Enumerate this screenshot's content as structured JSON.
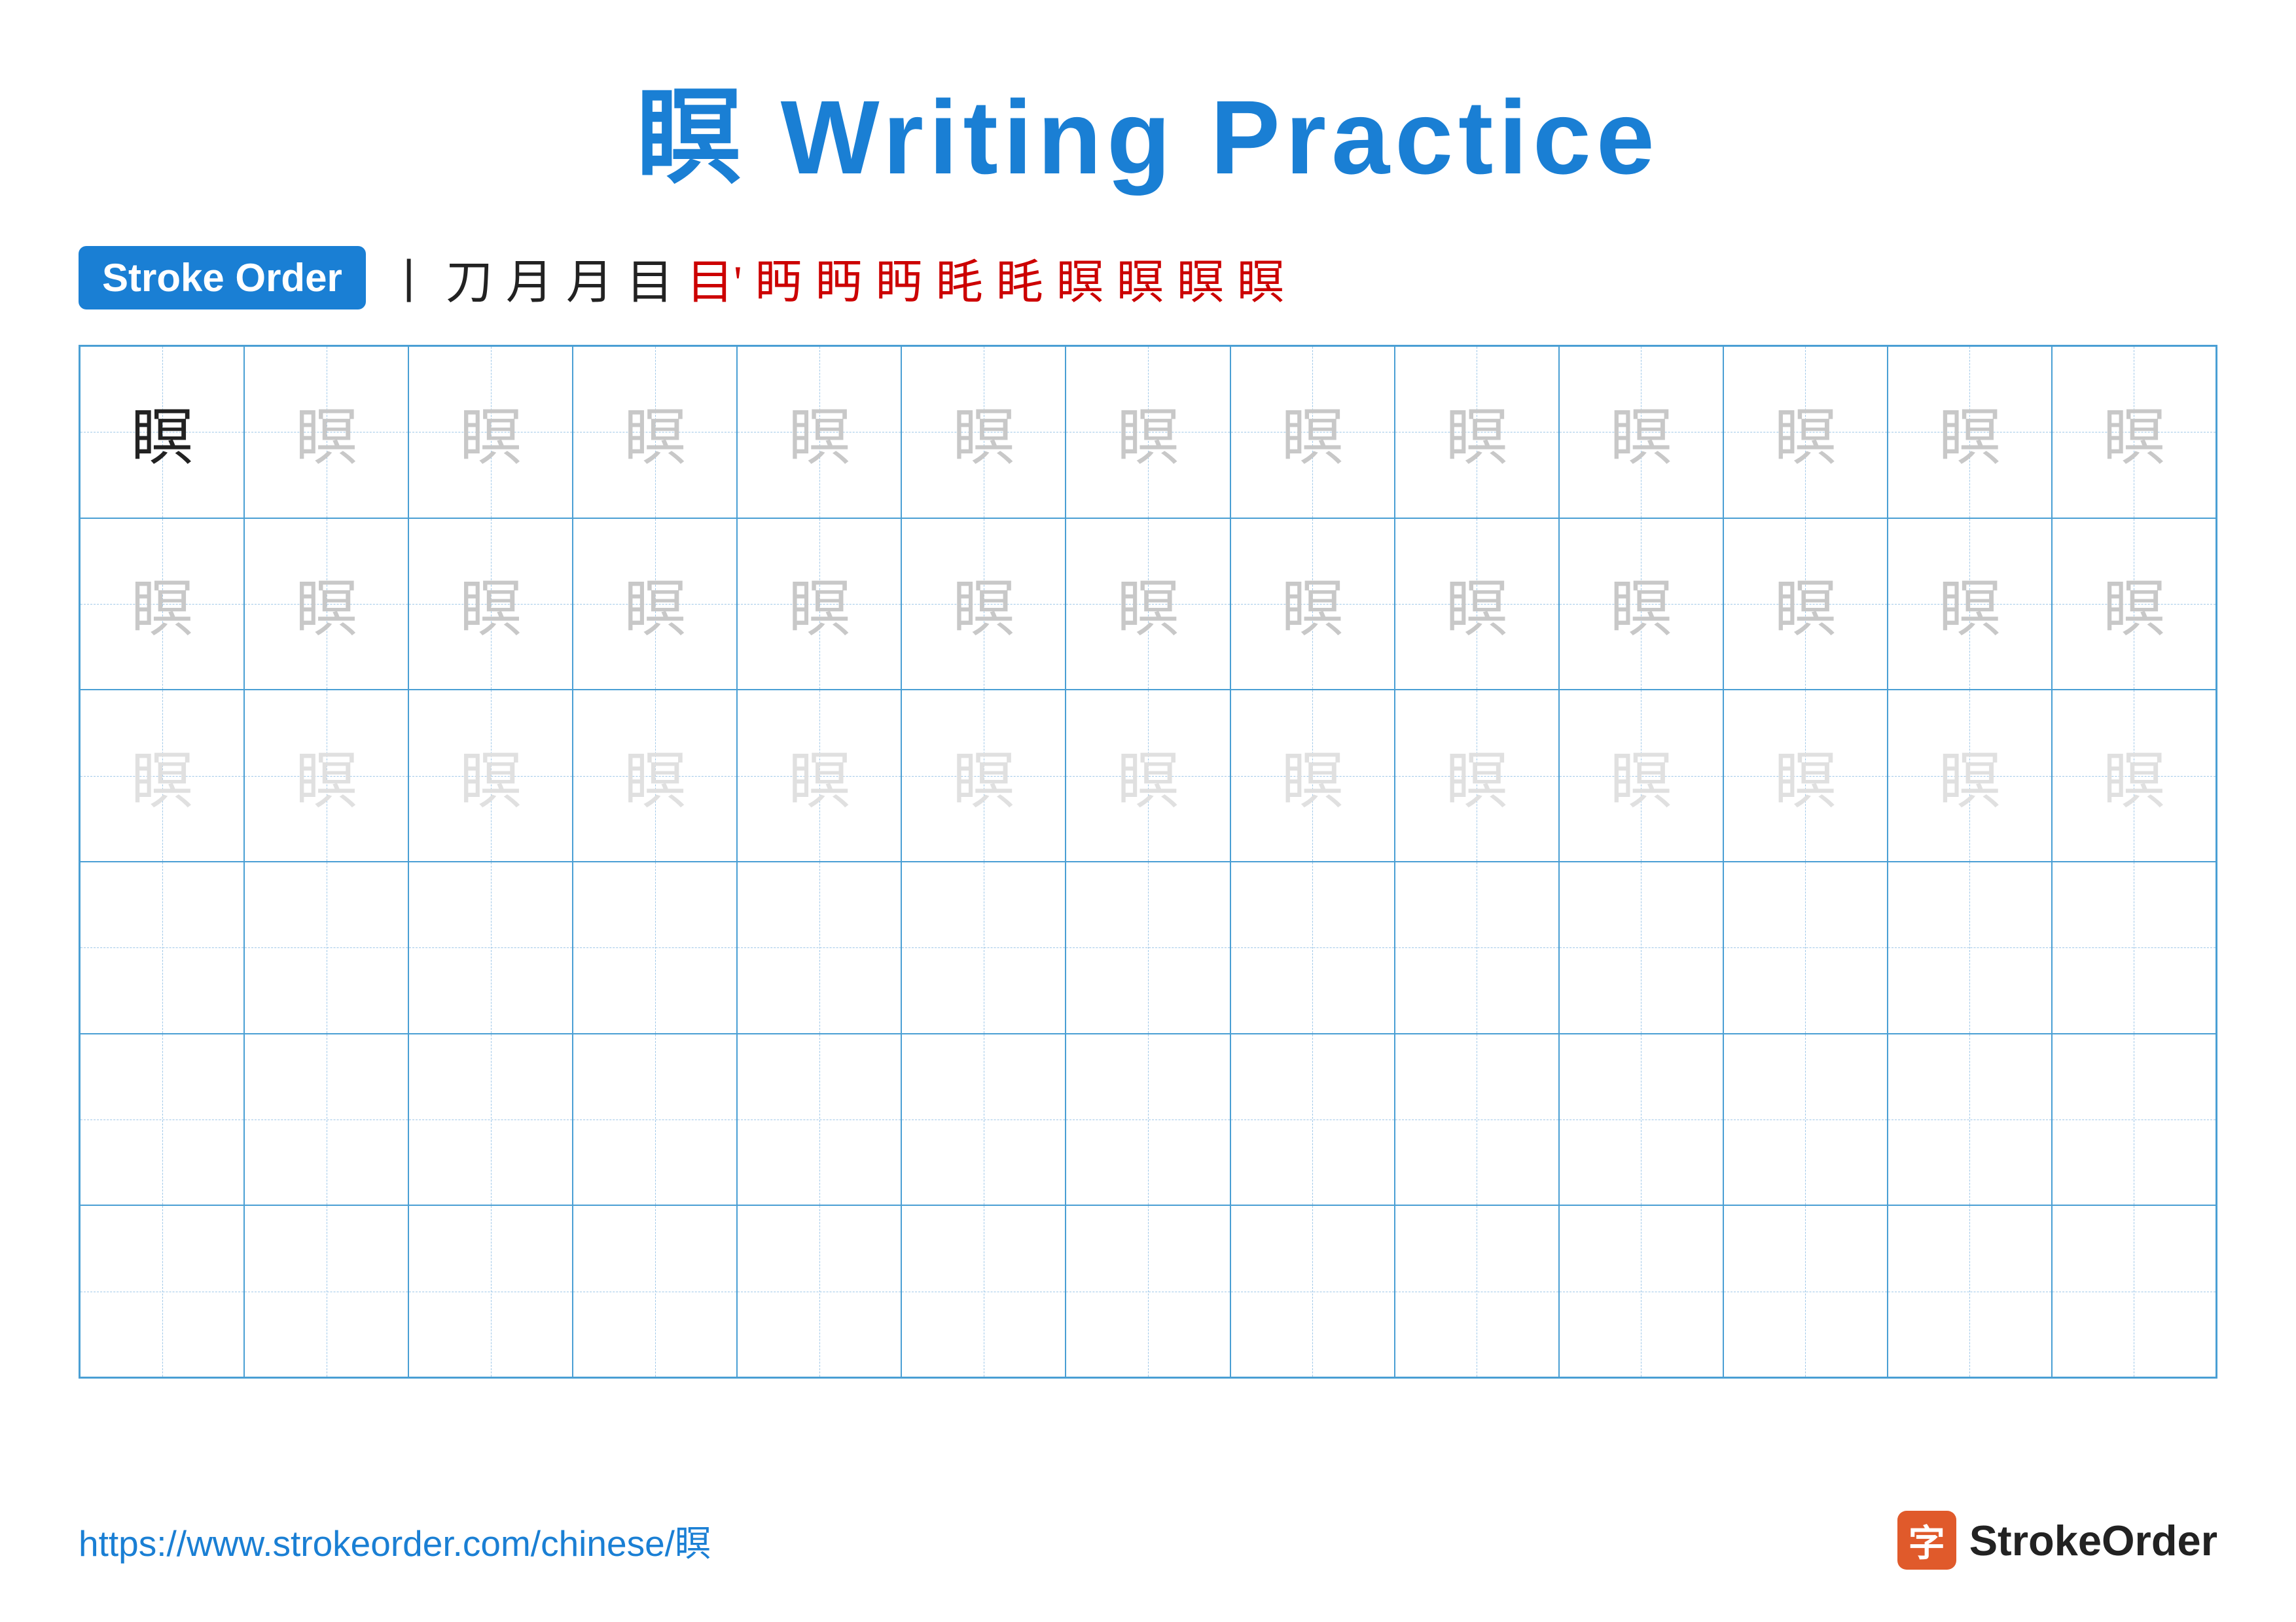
{
  "title": {
    "text": "瞑 Writing Practice",
    "char": "瞑"
  },
  "stroke_order": {
    "badge_label": "Stroke Order",
    "chars": [
      "丨",
      "刀",
      "月",
      "月",
      "目",
      "目'",
      "眄",
      "眄",
      "眄",
      "眄",
      "眊",
      "眊",
      "瞑",
      "瞑",
      "瞑"
    ]
  },
  "grid": {
    "character": "瞑",
    "rows": 6,
    "cols": 13,
    "row_styles": [
      "dark",
      "medium-gray",
      "medium-gray",
      "very-light",
      "very-light",
      "very-light"
    ]
  },
  "footer": {
    "url": "https://www.strokeorder.com/chinese/瞑",
    "logo_char": "字",
    "logo_text": "StrokeOrder"
  }
}
